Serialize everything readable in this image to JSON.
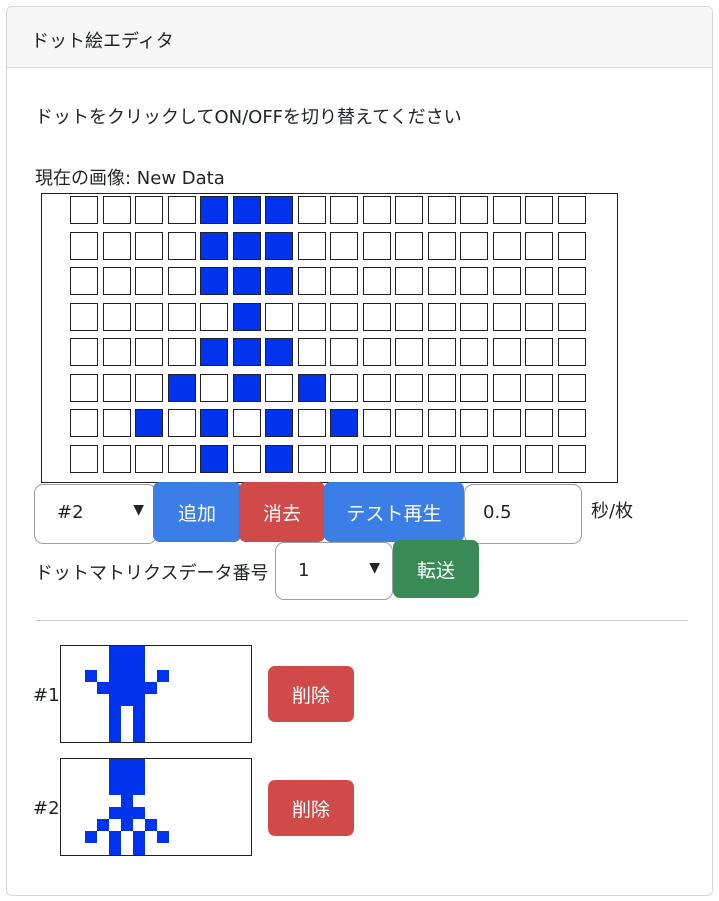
{
  "header": {
    "title": "ドット絵エディタ"
  },
  "instruction": "ドットをクリックしてON/OFFを切り替えてください",
  "current_image_label": "現在の画像: New Data",
  "matrix": {
    "rows": 8,
    "cols": 16,
    "on_color": "#0033ee",
    "cells": [
      "0000111000000000",
      "0000111000000000",
      "0000111000000000",
      "0000010000000000",
      "0000111000000000",
      "0001010100000000",
      "0010101010000000",
      "0000101000000000"
    ]
  },
  "controls": {
    "frame_select": "#2",
    "add_label": "追加",
    "clear_label": "消去",
    "play_label": "テスト再生",
    "interval_value": "0.5",
    "interval_unit": "秒/枚",
    "data_number_label": "ドットマトリクスデータ番号",
    "data_number_select": "1",
    "transfer_label": "転送"
  },
  "frames": [
    {
      "label": "#1",
      "delete_label": "削除",
      "cells": [
        "0000111000000000",
        "0000111000000000",
        "0010111010000000",
        "0001111100000000",
        "0000111000000000",
        "0000101000000000",
        "0000101000000000",
        "0000101000000000"
      ]
    },
    {
      "label": "#2",
      "delete_label": "削除",
      "cells": [
        "0000111000000000",
        "0000111000000000",
        "0000111000000000",
        "0000010000000000",
        "0000111000000000",
        "0001010100000000",
        "0010101010000000",
        "0000101000000000"
      ]
    }
  ]
}
